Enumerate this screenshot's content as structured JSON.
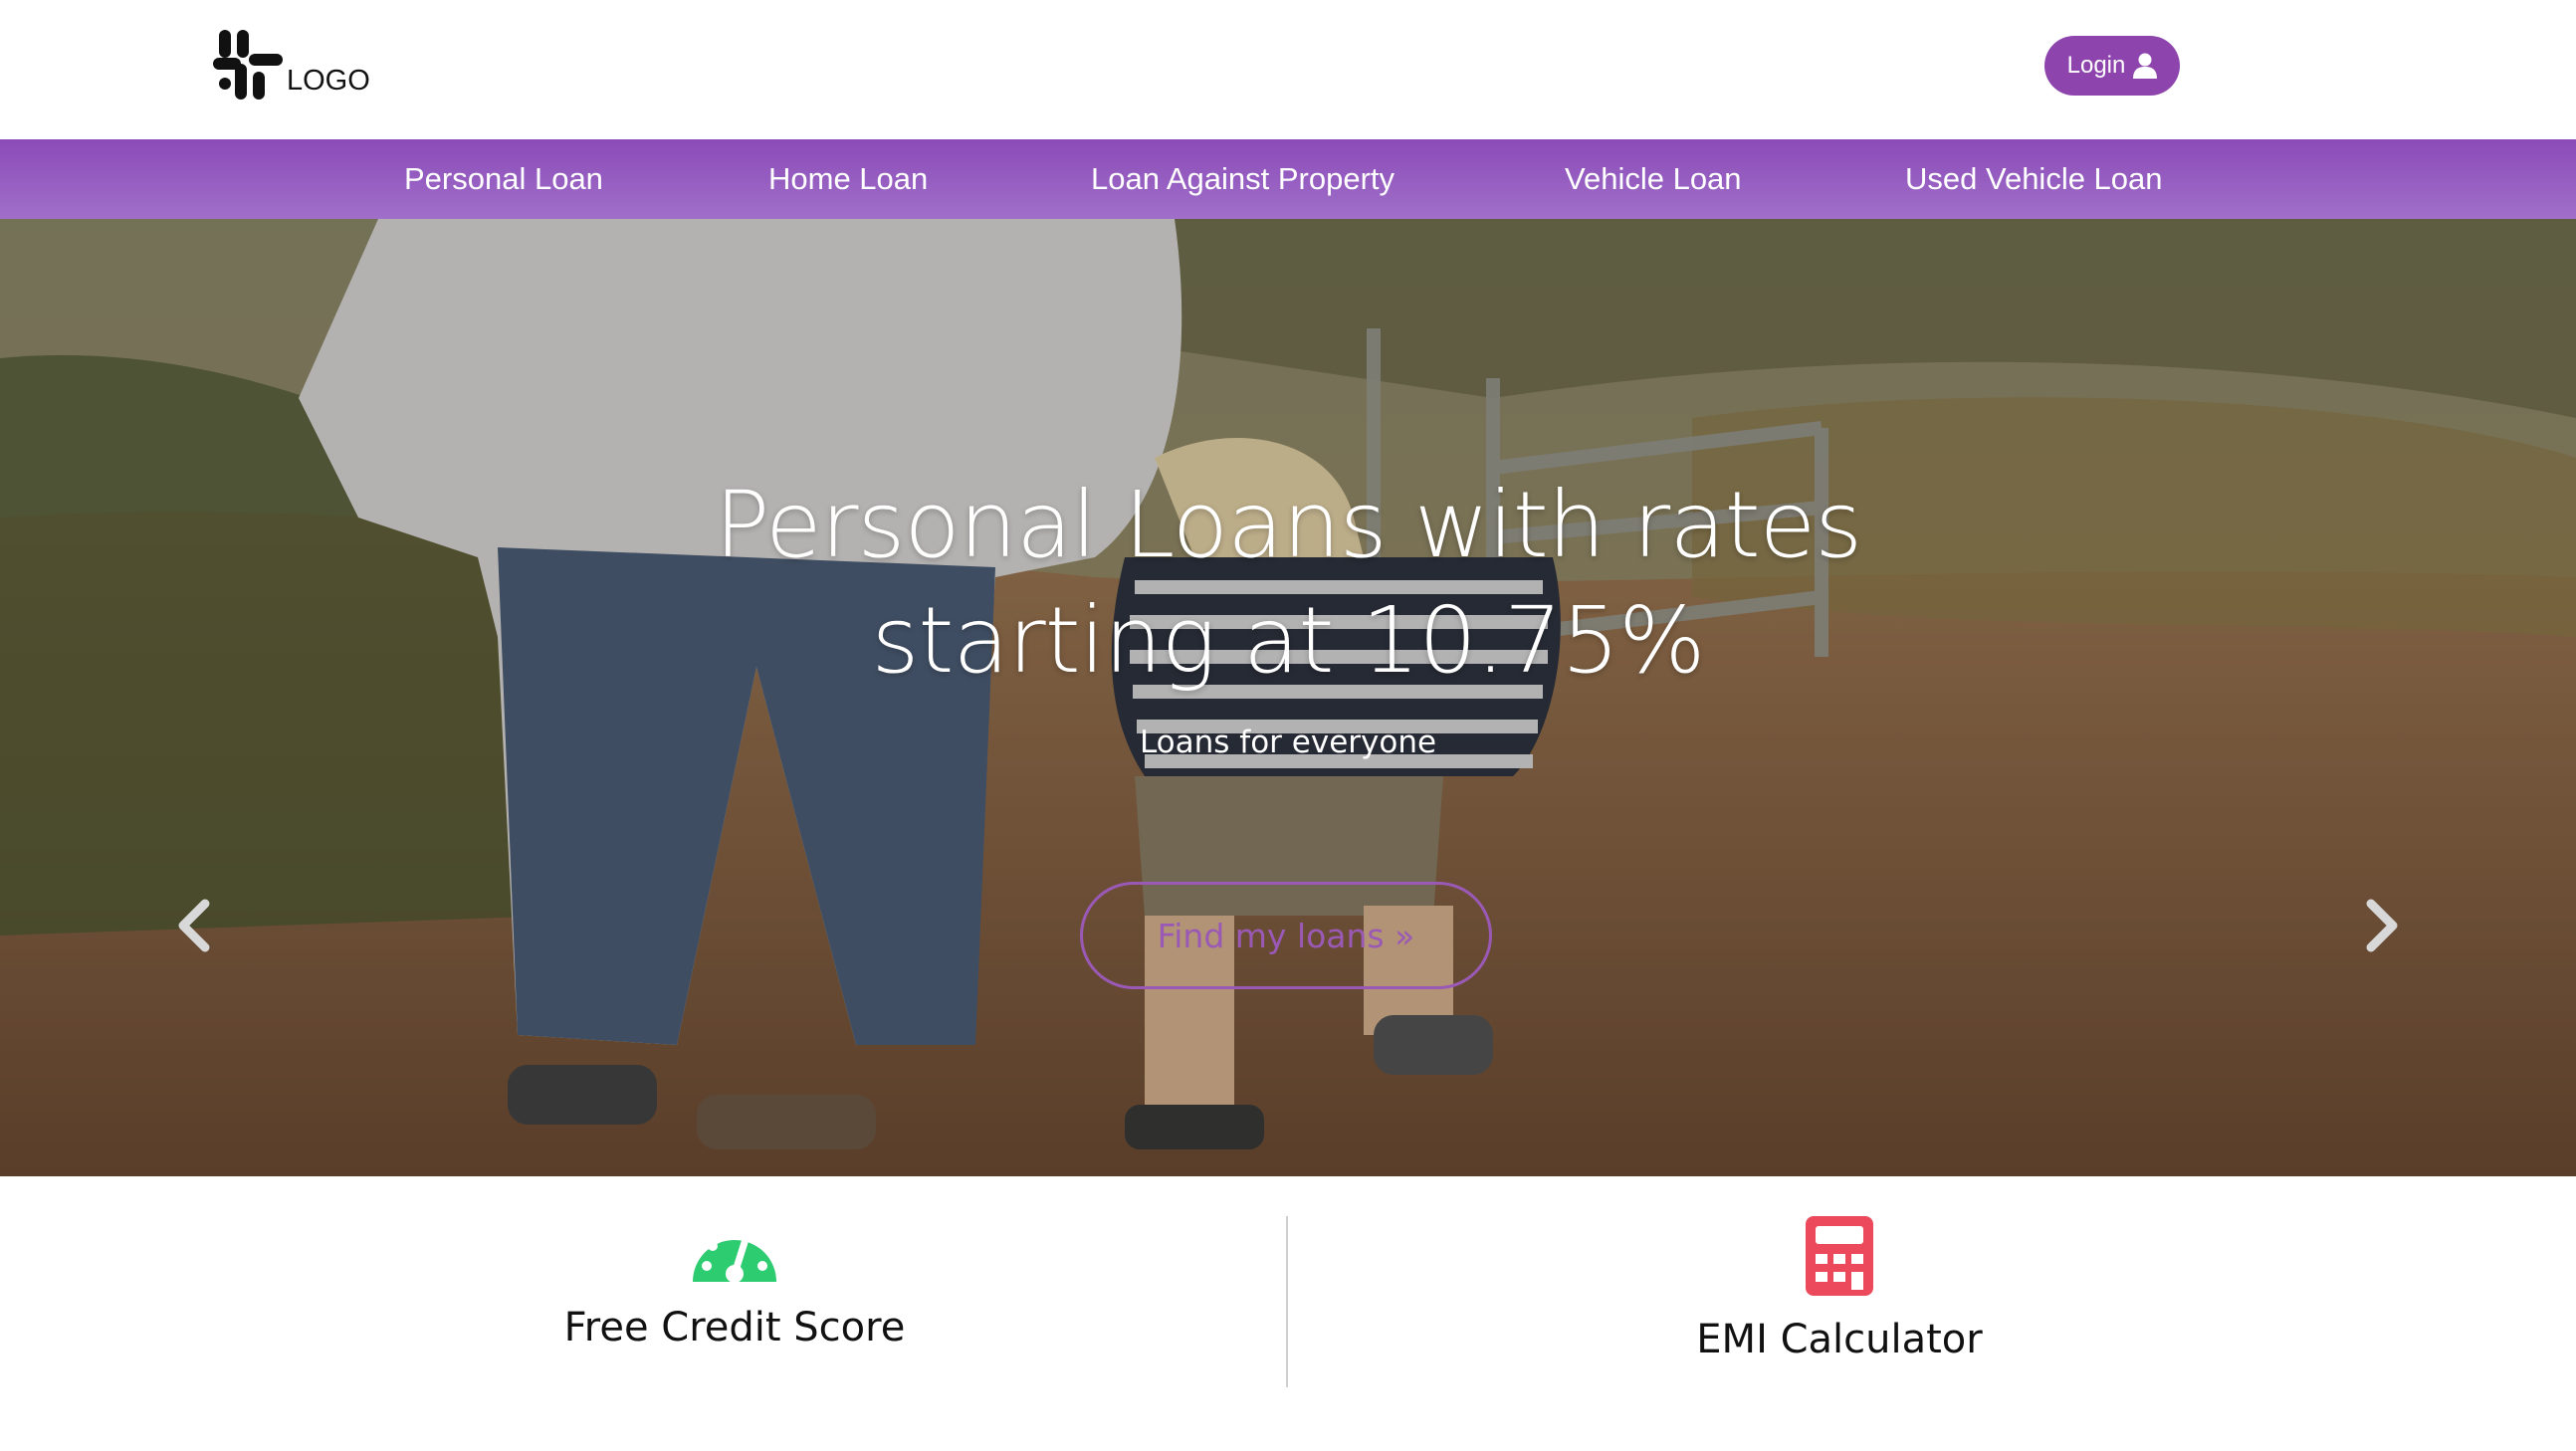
{
  "header": {
    "logo_text": "LOGO",
    "login_label": "Login",
    "login_icon": "user-icon"
  },
  "nav": {
    "items": [
      {
        "label": "Personal Loan"
      },
      {
        "label": "Home Loan"
      },
      {
        "label": "Loan Against Property"
      },
      {
        "label": "Vehicle Loan"
      },
      {
        "label": "Used Vehicle Loan"
      }
    ]
  },
  "hero": {
    "title": "Personal Loans with rates starting at 10.75%",
    "subtitle": "Loans for everyone",
    "cta_label": "Find my loans »",
    "prev_icon": "chevron-left-icon",
    "next_icon": "chevron-right-icon"
  },
  "features": [
    {
      "label": "Free Credit Score",
      "icon": "speedometer-icon",
      "color": "#27ae60"
    },
    {
      "label": "EMI Calculator",
      "icon": "calculator-icon",
      "color": "#e74c5c"
    }
  ],
  "colors": {
    "accent": "#8e44ad",
    "nav_gradient_top": "#8b4bb8",
    "nav_gradient_bottom": "#a06fc9"
  }
}
